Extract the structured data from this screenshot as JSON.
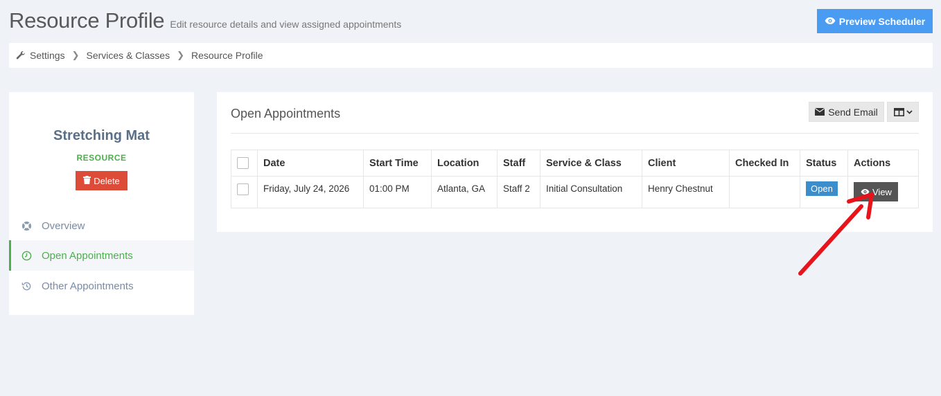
{
  "header": {
    "title": "Resource Profile",
    "subtitle": "Edit resource details and view assigned appointments",
    "preview_button": "Preview Scheduler"
  },
  "breadcrumb": [
    "Settings",
    "Services & Classes",
    "Resource Profile"
  ],
  "resource": {
    "name": "Stretching Mat",
    "type": "RESOURCE",
    "delete_label": "Delete"
  },
  "nav": {
    "items": [
      {
        "label": "Overview",
        "icon": "lifebuoy-icon",
        "active": false
      },
      {
        "label": "Open Appointments",
        "icon": "clock-icon",
        "active": true
      },
      {
        "label": "Other Appointments",
        "icon": "history-icon",
        "active": false
      }
    ]
  },
  "panel": {
    "title": "Open Appointments",
    "send_email": "Send Email",
    "columns_icon": "columns-icon"
  },
  "table": {
    "headers": [
      "Date",
      "Start Time",
      "Location",
      "Staff",
      "Service & Class",
      "Client",
      "Checked In",
      "Status",
      "Actions"
    ],
    "rows": [
      {
        "date": "Friday, July 24, 2026",
        "start_time": "01:00 PM",
        "location": "Atlanta, GA",
        "staff": "Staff 2",
        "service": "Initial Consultation",
        "client": "Henry Chestnut",
        "checked_in": "",
        "status": "Open",
        "action": "View"
      }
    ]
  },
  "colors": {
    "accent_blue": "#4a9cf2",
    "green": "#4cae4c",
    "danger": "#dd4b39",
    "status_blue": "#3c8dcc",
    "annotation_red": "#e8141b"
  }
}
